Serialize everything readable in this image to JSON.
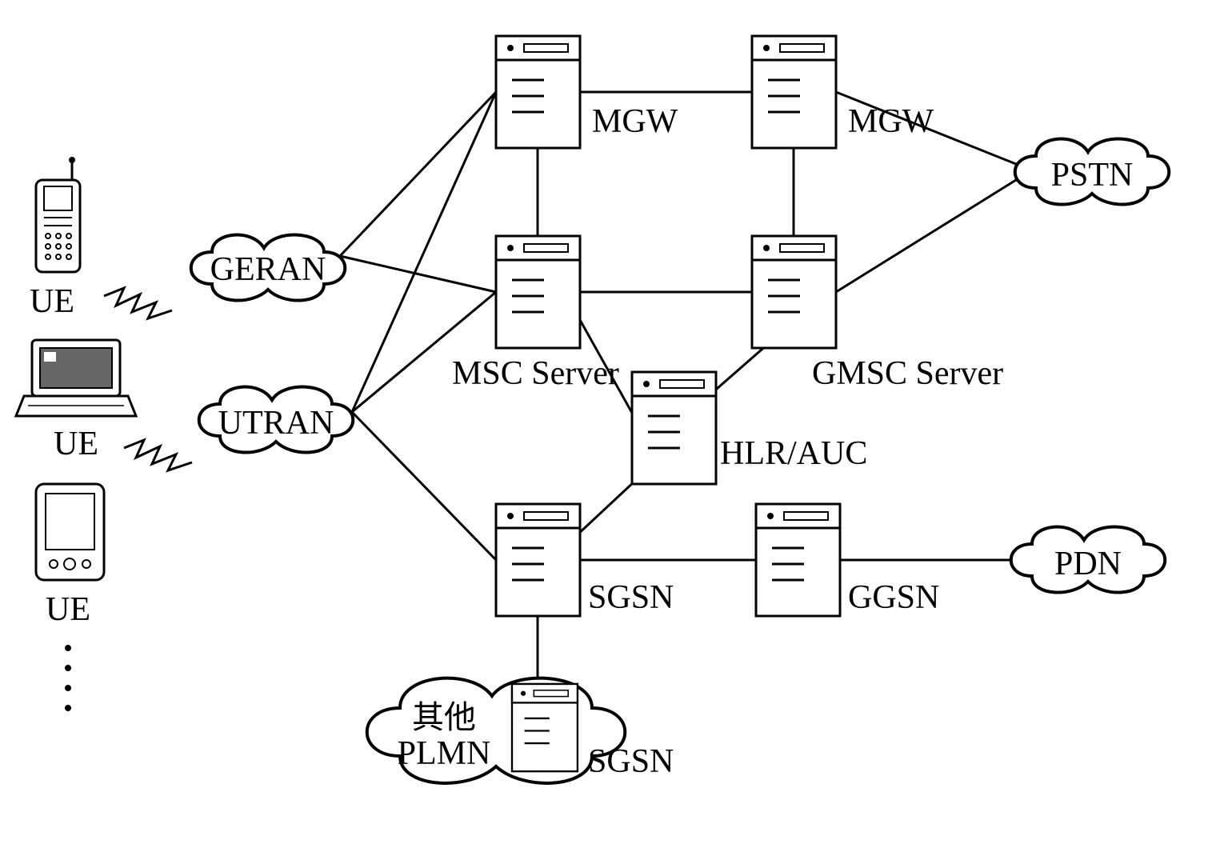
{
  "labels": {
    "ue1": "UE",
    "ue2": "UE",
    "ue3": "UE",
    "geran": "GERAN",
    "utran": "UTRAN",
    "mgw1": "MGW",
    "mgw2": "MGW",
    "msc": "MSC Server",
    "gmsc": "GMSC Server",
    "hlr": "HLR/AUC",
    "sgsn": "SGSN",
    "ggsn": "GGSN",
    "plmn_other": "其他",
    "plmn": "PLMN",
    "sgsn2": "SGSN",
    "pstn": "PSTN",
    "pdn": "PDN"
  }
}
